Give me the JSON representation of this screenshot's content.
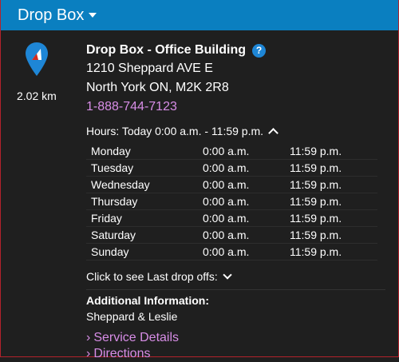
{
  "header": {
    "title": "Drop Box"
  },
  "location": {
    "distance": "2.02 km",
    "name": "Drop Box - Office Building",
    "address_line1": "1210 Sheppard AVE E",
    "address_line2": "North York ON, M2K 2R8",
    "phone": "1-888-744-7123"
  },
  "hours": {
    "summary": "Hours: Today 0:00 a.m. - 11:59 p.m.",
    "rows": [
      {
        "day": "Monday",
        "open": "0:00 a.m.",
        "close": "11:59 p.m."
      },
      {
        "day": "Tuesday",
        "open": "0:00 a.m.",
        "close": "11:59 p.m."
      },
      {
        "day": "Wednesday",
        "open": "0:00 a.m.",
        "close": "11:59 p.m."
      },
      {
        "day": "Thursday",
        "open": "0:00 a.m.",
        "close": "11:59 p.m."
      },
      {
        "day": "Friday",
        "open": "0:00 a.m.",
        "close": "11:59 p.m."
      },
      {
        "day": "Saturday",
        "open": "0:00 a.m.",
        "close": "11:59 p.m."
      },
      {
        "day": "Sunday",
        "open": "0:00 a.m.",
        "close": "11:59 p.m."
      }
    ]
  },
  "last_drop": {
    "label": "Click to see Last drop offs:"
  },
  "additional": {
    "label": "Additional Information:",
    "text": "Sheppard & Leslie"
  },
  "links": {
    "service_details": "Service Details",
    "directions": "Directions",
    "arrow": "›"
  },
  "icons": {
    "help": "?",
    "pin": "location-pin-icon"
  },
  "colors": {
    "header_bg": "#0a7fc0",
    "panel_bg": "#1f1f1f",
    "border": "#b3222b",
    "link": "#d78de6",
    "pin": "#1e86d6",
    "help": "#1e86d6"
  }
}
